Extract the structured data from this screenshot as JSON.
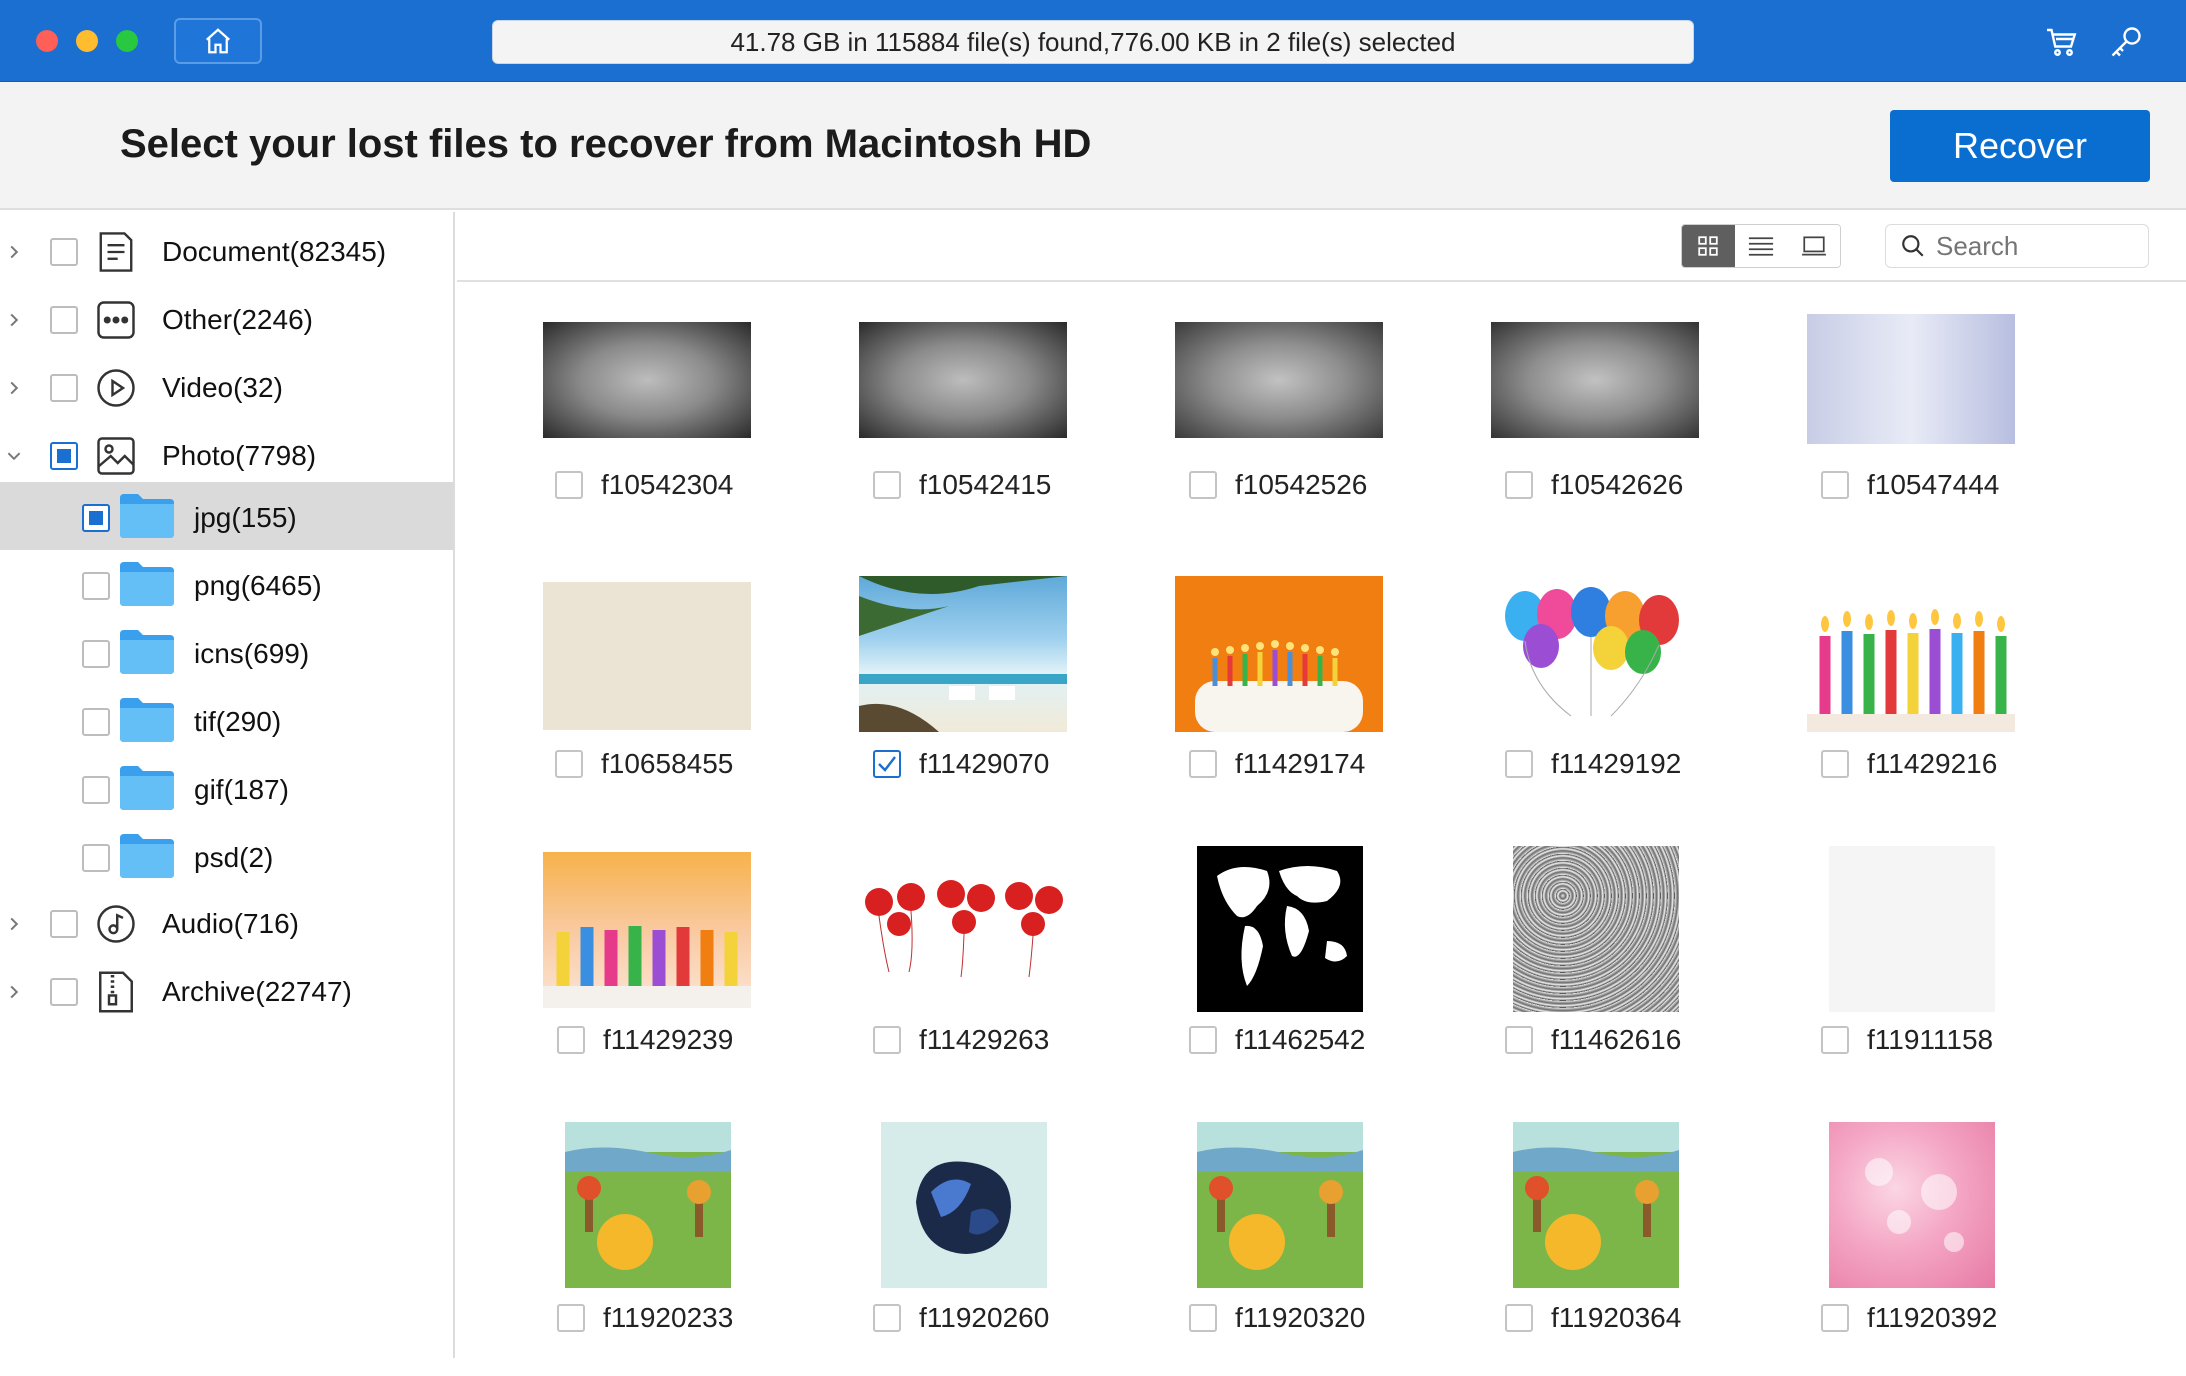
{
  "titlebar": {
    "status": "41.78 GB in 115884 file(s) found,776.00 KB in 2 file(s) selected"
  },
  "header": {
    "headline": "Select your lost files to recover from Macintosh HD",
    "recover_label": "Recover"
  },
  "search": {
    "placeholder": "Search"
  },
  "sidebar": {
    "categories": [
      {
        "label": "Document(82345)",
        "icon": "document-icon"
      },
      {
        "label": "Other(2246)",
        "icon": "more-icon"
      },
      {
        "label": "Video(32)",
        "icon": "video-icon"
      },
      {
        "label": "Photo(7798)",
        "icon": "photo-icon"
      },
      {
        "label": "Audio(716)",
        "icon": "audio-icon"
      },
      {
        "label": "Archive(22747)",
        "icon": "archive-icon"
      }
    ],
    "photo_children": [
      {
        "label": "jpg(155)"
      },
      {
        "label": "png(6465)"
      },
      {
        "label": "icns(699)"
      },
      {
        "label": "tif(290)"
      },
      {
        "label": "gif(187)"
      },
      {
        "label": "psd(2)"
      }
    ]
  },
  "files": [
    {
      "name": "f10542304",
      "checked": false
    },
    {
      "name": "f10542415",
      "checked": false
    },
    {
      "name": "f10542526",
      "checked": false
    },
    {
      "name": "f10542626",
      "checked": false
    },
    {
      "name": "f10547444",
      "checked": false
    },
    {
      "name": "f10658455",
      "checked": false
    },
    {
      "name": "f11429070",
      "checked": true
    },
    {
      "name": "f11429174",
      "checked": false
    },
    {
      "name": "f11429192",
      "checked": false
    },
    {
      "name": "f11429216",
      "checked": false
    },
    {
      "name": "f11429239",
      "checked": false
    },
    {
      "name": "f11429263",
      "checked": false
    },
    {
      "name": "f11462542",
      "checked": false
    },
    {
      "name": "f11462616",
      "checked": false
    },
    {
      "name": "f11911158",
      "checked": false
    },
    {
      "name": "f11920233",
      "checked": false
    },
    {
      "name": "f11920260",
      "checked": false
    },
    {
      "name": "f11920320",
      "checked": false
    },
    {
      "name": "f11920364",
      "checked": false
    },
    {
      "name": "f11920392",
      "checked": false
    }
  ],
  "colors": {
    "titlebar": "#1a6fd0",
    "accent": "#0a6ed1",
    "selected_row": "#dadada"
  }
}
